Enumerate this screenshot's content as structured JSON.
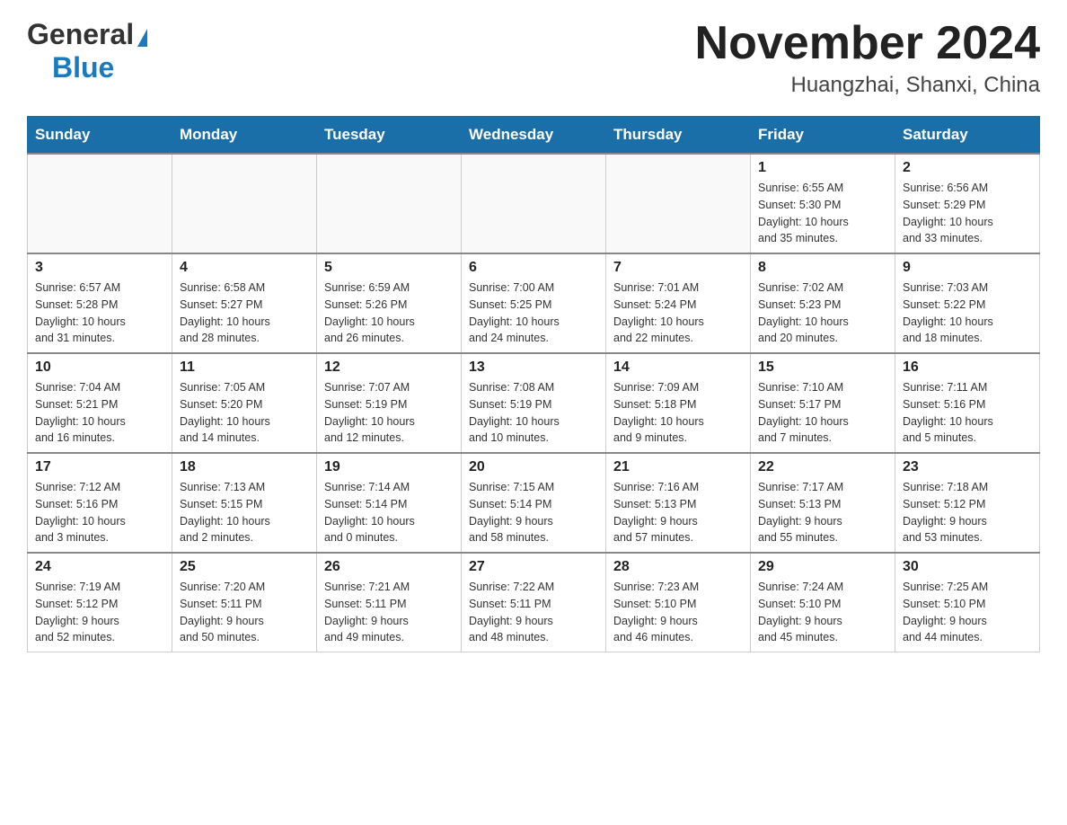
{
  "header": {
    "logo_general": "General",
    "logo_blue": "Blue",
    "title": "November 2024",
    "subtitle": "Huangzhai, Shanxi, China"
  },
  "weekdays": [
    "Sunday",
    "Monday",
    "Tuesday",
    "Wednesday",
    "Thursday",
    "Friday",
    "Saturday"
  ],
  "weeks": [
    [
      {
        "day": "",
        "info": ""
      },
      {
        "day": "",
        "info": ""
      },
      {
        "day": "",
        "info": ""
      },
      {
        "day": "",
        "info": ""
      },
      {
        "day": "",
        "info": ""
      },
      {
        "day": "1",
        "info": "Sunrise: 6:55 AM\nSunset: 5:30 PM\nDaylight: 10 hours\nand 35 minutes."
      },
      {
        "day": "2",
        "info": "Sunrise: 6:56 AM\nSunset: 5:29 PM\nDaylight: 10 hours\nand 33 minutes."
      }
    ],
    [
      {
        "day": "3",
        "info": "Sunrise: 6:57 AM\nSunset: 5:28 PM\nDaylight: 10 hours\nand 31 minutes."
      },
      {
        "day": "4",
        "info": "Sunrise: 6:58 AM\nSunset: 5:27 PM\nDaylight: 10 hours\nand 28 minutes."
      },
      {
        "day": "5",
        "info": "Sunrise: 6:59 AM\nSunset: 5:26 PM\nDaylight: 10 hours\nand 26 minutes."
      },
      {
        "day": "6",
        "info": "Sunrise: 7:00 AM\nSunset: 5:25 PM\nDaylight: 10 hours\nand 24 minutes."
      },
      {
        "day": "7",
        "info": "Sunrise: 7:01 AM\nSunset: 5:24 PM\nDaylight: 10 hours\nand 22 minutes."
      },
      {
        "day": "8",
        "info": "Sunrise: 7:02 AM\nSunset: 5:23 PM\nDaylight: 10 hours\nand 20 minutes."
      },
      {
        "day": "9",
        "info": "Sunrise: 7:03 AM\nSunset: 5:22 PM\nDaylight: 10 hours\nand 18 minutes."
      }
    ],
    [
      {
        "day": "10",
        "info": "Sunrise: 7:04 AM\nSunset: 5:21 PM\nDaylight: 10 hours\nand 16 minutes."
      },
      {
        "day": "11",
        "info": "Sunrise: 7:05 AM\nSunset: 5:20 PM\nDaylight: 10 hours\nand 14 minutes."
      },
      {
        "day": "12",
        "info": "Sunrise: 7:07 AM\nSunset: 5:19 PM\nDaylight: 10 hours\nand 12 minutes."
      },
      {
        "day": "13",
        "info": "Sunrise: 7:08 AM\nSunset: 5:19 PM\nDaylight: 10 hours\nand 10 minutes."
      },
      {
        "day": "14",
        "info": "Sunrise: 7:09 AM\nSunset: 5:18 PM\nDaylight: 10 hours\nand 9 minutes."
      },
      {
        "day": "15",
        "info": "Sunrise: 7:10 AM\nSunset: 5:17 PM\nDaylight: 10 hours\nand 7 minutes."
      },
      {
        "day": "16",
        "info": "Sunrise: 7:11 AM\nSunset: 5:16 PM\nDaylight: 10 hours\nand 5 minutes."
      }
    ],
    [
      {
        "day": "17",
        "info": "Sunrise: 7:12 AM\nSunset: 5:16 PM\nDaylight: 10 hours\nand 3 minutes."
      },
      {
        "day": "18",
        "info": "Sunrise: 7:13 AM\nSunset: 5:15 PM\nDaylight: 10 hours\nand 2 minutes."
      },
      {
        "day": "19",
        "info": "Sunrise: 7:14 AM\nSunset: 5:14 PM\nDaylight: 10 hours\nand 0 minutes."
      },
      {
        "day": "20",
        "info": "Sunrise: 7:15 AM\nSunset: 5:14 PM\nDaylight: 9 hours\nand 58 minutes."
      },
      {
        "day": "21",
        "info": "Sunrise: 7:16 AM\nSunset: 5:13 PM\nDaylight: 9 hours\nand 57 minutes."
      },
      {
        "day": "22",
        "info": "Sunrise: 7:17 AM\nSunset: 5:13 PM\nDaylight: 9 hours\nand 55 minutes."
      },
      {
        "day": "23",
        "info": "Sunrise: 7:18 AM\nSunset: 5:12 PM\nDaylight: 9 hours\nand 53 minutes."
      }
    ],
    [
      {
        "day": "24",
        "info": "Sunrise: 7:19 AM\nSunset: 5:12 PM\nDaylight: 9 hours\nand 52 minutes."
      },
      {
        "day": "25",
        "info": "Sunrise: 7:20 AM\nSunset: 5:11 PM\nDaylight: 9 hours\nand 50 minutes."
      },
      {
        "day": "26",
        "info": "Sunrise: 7:21 AM\nSunset: 5:11 PM\nDaylight: 9 hours\nand 49 minutes."
      },
      {
        "day": "27",
        "info": "Sunrise: 7:22 AM\nSunset: 5:11 PM\nDaylight: 9 hours\nand 48 minutes."
      },
      {
        "day": "28",
        "info": "Sunrise: 7:23 AM\nSunset: 5:10 PM\nDaylight: 9 hours\nand 46 minutes."
      },
      {
        "day": "29",
        "info": "Sunrise: 7:24 AM\nSunset: 5:10 PM\nDaylight: 9 hours\nand 45 minutes."
      },
      {
        "day": "30",
        "info": "Sunrise: 7:25 AM\nSunset: 5:10 PM\nDaylight: 9 hours\nand 44 minutes."
      }
    ]
  ]
}
